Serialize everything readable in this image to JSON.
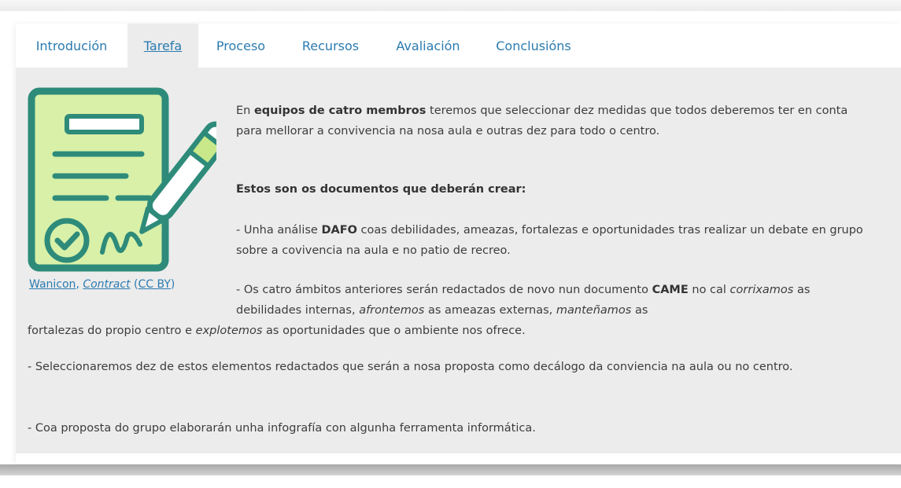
{
  "tabs": [
    {
      "label": "Introdución"
    },
    {
      "label": "Tarefa"
    },
    {
      "label": "Proceso"
    },
    {
      "label": "Recursos"
    },
    {
      "label": "Avaliación"
    },
    {
      "label": "Conclusións"
    }
  ],
  "colors": {
    "link": "#2b7bb0",
    "panel_bg": "#ececec",
    "icon_teal": "#2e8b7a",
    "icon_green": "#d8f0a8"
  },
  "illustration": {
    "icon": "contract-signing-icon"
  },
  "credit": {
    "author": "Wanicon",
    "sep": ", ",
    "title": "Contract",
    "open": " (",
    "license": "CC BY",
    "close": ")"
  },
  "content": {
    "p1": {
      "a": "En ",
      "b": "equipos de catro membros",
      "c": " teremos que seleccionar dez medidas que todos deberemos ter en conta para mellorar a convivencia na nosa aula e outras dez para todo o centro."
    },
    "heading": "Estos son os documentos que deberán crear:",
    "p2": {
      "a": " - Unha análise ",
      "b": "DAFO",
      "c": " coas debilidades, ameazas, fortalezas e oportunidades tras realizar un debate en grupo sobre a covivencia na aula e no patio de recreo."
    },
    "p3": {
      "a": "- Os catro ámbitos anteriores serán redactados de novo nun documento ",
      "b": "CAME",
      "c": " no cal ",
      "d": "corrixamos",
      "e": " as debilidades internas, ",
      "f": "afrontemos",
      "g": " as ameazas externas, ",
      "h": "manteñamos",
      "i": " as"
    },
    "p3b": {
      "a": "fortalezas do propio centro e ",
      "b": "explotemos",
      "c": " as oportunidades que o ambiente nos ofrece."
    },
    "p4": "- Seleccionaremos dez de estos elementos redactados que serán a nosa proposta como decálogo da conviencia na aula ou no centro.",
    "p5": "- Coa proposta do grupo elaborarán unha infografía con algunha ferramenta informática."
  }
}
